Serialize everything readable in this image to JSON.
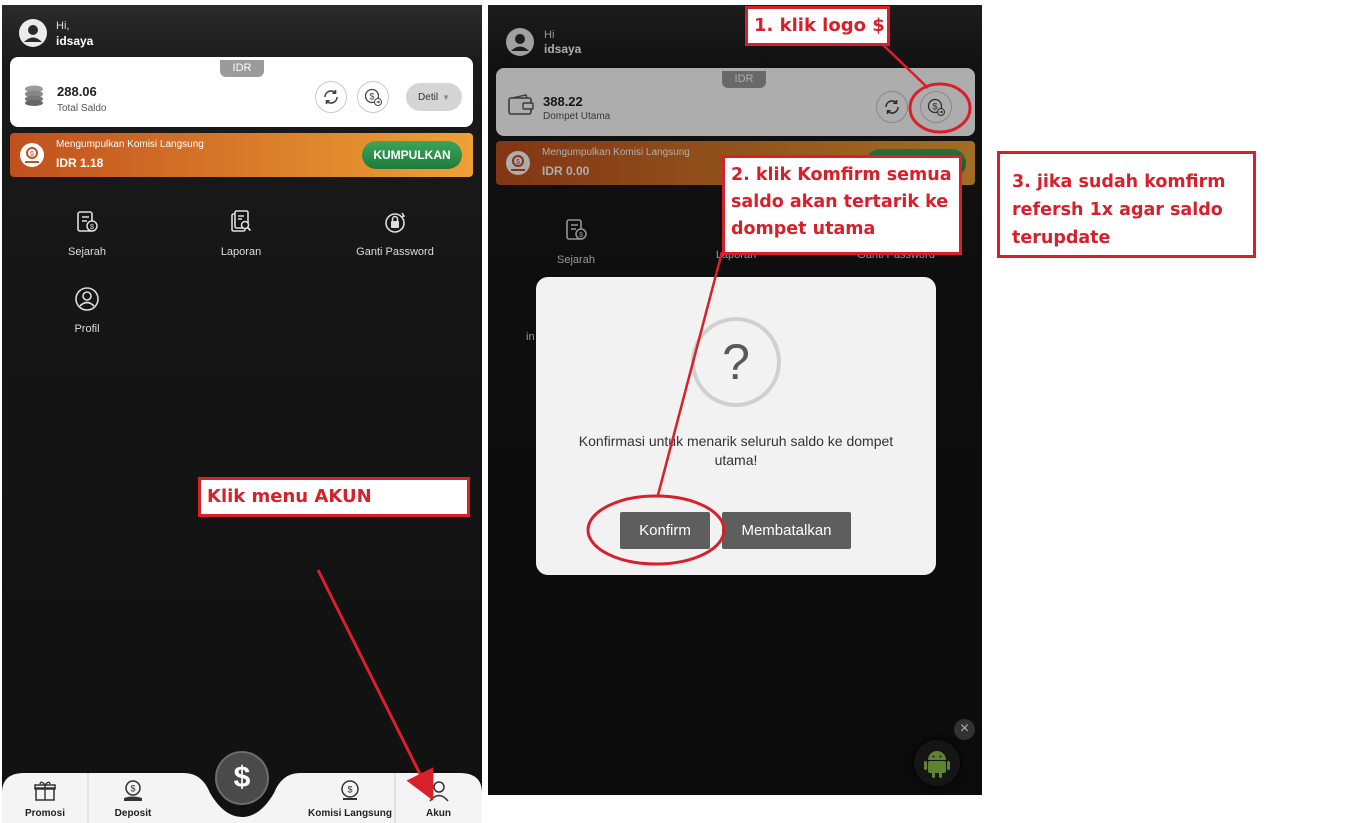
{
  "left_screen": {
    "greeting": "Hi,",
    "username": "idsaya",
    "currency_tab": "IDR",
    "balance_value": "288.06",
    "balance_label": "Total Saldo",
    "detail_label": "Detil",
    "komisi_title": "Mengumpulkan Komisi Langsung",
    "komisi_value": "IDR 1.18",
    "kumpulkan_label": "KUMPULKAN",
    "menu": [
      {
        "label": "Sejarah",
        "icon": "history-icon"
      },
      {
        "label": "Laporan",
        "icon": "report-icon"
      },
      {
        "label": "Ganti Password",
        "icon": "lock-icon"
      },
      {
        "label": "Profil",
        "icon": "profile-icon"
      }
    ],
    "bottom_nav": [
      {
        "label": "Promosi",
        "icon": "gift-icon"
      },
      {
        "label": "Deposit",
        "icon": "deposit-icon"
      },
      {
        "label": "Komisi Langsung",
        "icon": "commission-icon"
      },
      {
        "label": "Akun",
        "icon": "user-icon"
      }
    ],
    "center_icon": "$"
  },
  "right_screen": {
    "greeting": "Hi",
    "username": "idsaya",
    "currency_tab": "IDR",
    "balance_value": "388.22",
    "balance_label": "Dompet Utama",
    "komisi_title": "Mengumpulkan Komisi Langsung",
    "komisi_value": "IDR 0.00",
    "menu": [
      {
        "label": "Sejarah"
      },
      {
        "label": "Laporan"
      },
      {
        "label": "Ganti Password"
      }
    ],
    "partial_text": "in",
    "dialog": {
      "icon": "?",
      "message": "Konfirmasi untuk menarik seluruh saldo ke dompet utama!",
      "confirm_label": "Konfirm",
      "cancel_label": "Membatalkan"
    },
    "close_icon": "×"
  },
  "annotations": {
    "step_left": "Klik menu AKUN",
    "step1": "1. klik logo $",
    "step2": "2. klik Komfirm semua saldo akan tertarik ke dompet utama",
    "step3": "3. jika sudah komfirm refersh 1x agar saldo terupdate"
  },
  "colors": {
    "annotation_red": "#d8202a",
    "kumpulkan_green": "#2a9048",
    "komisi_orange": "#e08a30",
    "dialog_button": "#5e5e5e"
  }
}
